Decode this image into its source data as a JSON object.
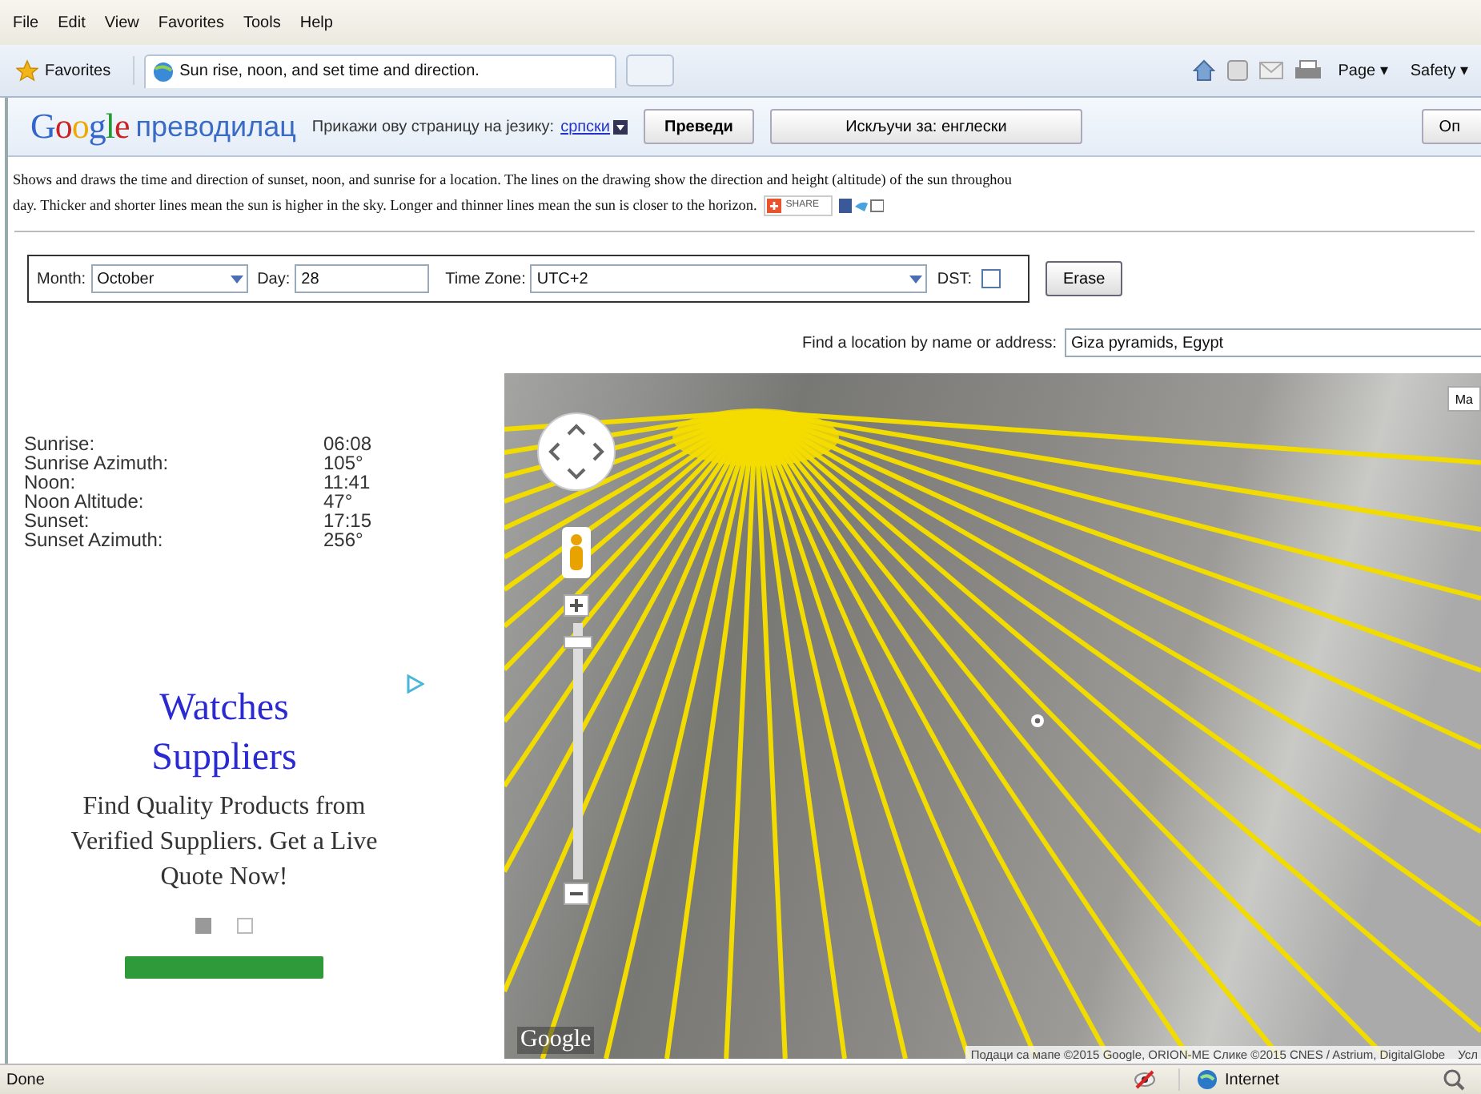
{
  "menu_bar": [
    "File",
    "Edit",
    "View",
    "Favorites",
    "Tools",
    "Help"
  ],
  "toolbar": {
    "favorites": "Favorites",
    "tab_title": "Sun rise, noon, and set time and direction.",
    "commands": [
      "Page ▾",
      "Safety ▾"
    ]
  },
  "translate_bar": {
    "logo": "Google",
    "product": "преводилац",
    "prompt": "Прикажи ову страницу на језику:",
    "language": "српски",
    "translate_button": "Преведи",
    "turn_off_button": "Искључи за: енглески",
    "options_button": "Оп"
  },
  "description": [
    "Shows and draws the time and direction of sunset, noon, and sunrise for a location. The lines on the drawing show the direction and height (altitude) of the sun throughou",
    "day. Thicker and shorter lines mean the sun is higher in the sky. Longer and thinner lines mean the sun is closer to the horizon."
  ],
  "share": {
    "label": "SHARE"
  },
  "form": {
    "month_label": "Month:",
    "month": "October",
    "day_label": "Day:",
    "day": "28",
    "timezone_label": "Time Zone:",
    "timezone": "UTC+2",
    "dst_label": "DST:",
    "dst_checked": false,
    "erase_button": "Erase"
  },
  "location": {
    "label": "Find a location by name or address:",
    "value": "Giza pyramids, Egypt"
  },
  "results": [
    {
      "label": "Sunrise:",
      "value": "06:08"
    },
    {
      "label": "Sunrise Azimuth:",
      "value": "105°"
    },
    {
      "label": "Noon:",
      "value": "11:41"
    },
    {
      "label": "Noon Altitude:",
      "value": "47°"
    },
    {
      "label": "Sunset:",
      "value": "17:15"
    },
    {
      "label": "Sunset Azimuth:",
      "value": "256°"
    }
  ],
  "ad": {
    "title": "Watches Suppliers",
    "body": "Find Quality Products from Verified Suppliers. Get a Live Quote Now!",
    "dots": [
      {
        "selected": true
      },
      {
        "selected": false
      }
    ]
  },
  "map": {
    "map_type_button": "Ma",
    "logo": "Google",
    "attribution": "Подаци са мапе ©2015 Google, ORION-ME Слике ©2015 CNES / Astrium, DigitalGlobe",
    "terms": "Усл",
    "zoom_slider": {
      "level": 0.95
    }
  },
  "status_bar": {
    "text": "Done",
    "zone": "Internet"
  }
}
